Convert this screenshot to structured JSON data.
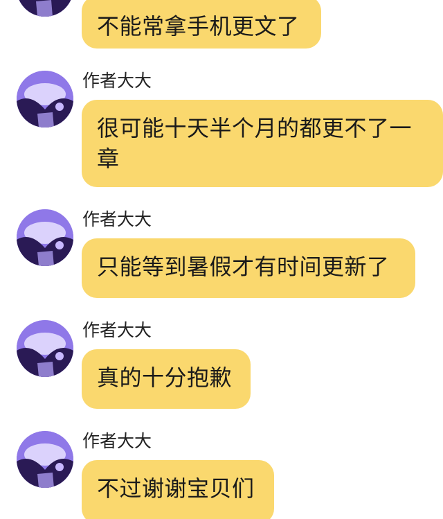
{
  "messages": [
    {
      "sender": "",
      "text": "不能常拿手机更文了"
    },
    {
      "sender": "作者大大",
      "text": "很可能十天半个月的都更不了一章"
    },
    {
      "sender": "作者大大",
      "text": "只能等到暑假才有时间更新了"
    },
    {
      "sender": "作者大大",
      "text": "真的十分抱歉"
    },
    {
      "sender": "作者大大",
      "text": "不过谢谢宝贝们"
    }
  ],
  "colors": {
    "bubble": "#fad86e",
    "avatar_primary": "#a48cf4",
    "avatar_dark": "#2a1a55"
  },
  "icons": {
    "avatar": "avatar-image"
  }
}
